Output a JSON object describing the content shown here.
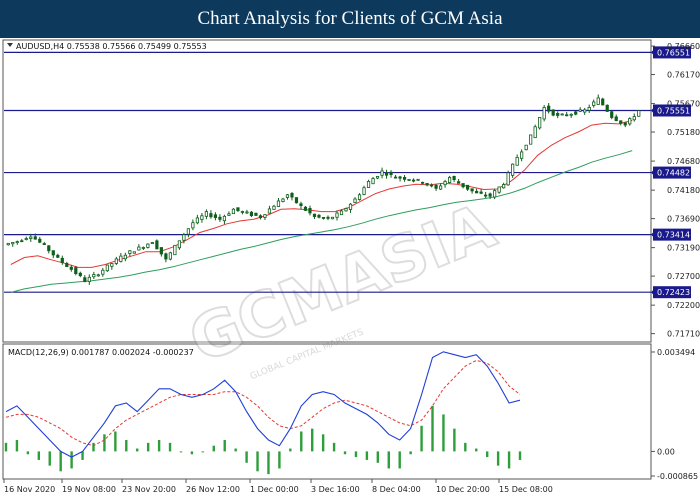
{
  "header": {
    "title": "Chart Analysis for Clients of GCM Asia"
  },
  "watermark": {
    "text": "GCMASIA",
    "subtext": "GLOBAL CAPITAL MARKETS"
  },
  "colors": {
    "level_line": "#1a1a8c",
    "level_label_bg": "#1a1a8c",
    "ma_fast": "#e53935",
    "ma_slow": "#2e9e5b",
    "candles": "#0f5f1c",
    "macd_line": "#1f3fd6",
    "macd_signal": "#e53935",
    "macd_hist": "#2e9e3a"
  },
  "chart_data": [
    {
      "type": "candlestick",
      "symbol_label": "AUDUSD,H4  0.75538 0.75566 0.75499 0.75553",
      "x_tick_labels": [
        "16 Nov 2020",
        "19 Nov 08:00",
        "23 Nov 20:00",
        "26 Nov 12:00",
        "1 Dec 00:00",
        "3 Dec 16:00",
        "8 Dec 04:00",
        "10 Dec 20:00",
        "15 Dec 08:00"
      ],
      "y_tick_labels": [
        "0.76660",
        "0.76170",
        "0.75670",
        "0.75180",
        "0.74680",
        "0.74180",
        "0.73690",
        "0.73190",
        "0.72700",
        "0.72200",
        "0.71710"
      ],
      "ylim": [
        0.716,
        0.7673
      ],
      "levels": [
        "0.76551",
        "0.75551",
        "0.74482",
        "0.73414",
        "0.72423"
      ],
      "close_path": [
        0.733,
        0.734,
        0.7322,
        0.73,
        0.7282,
        0.7262,
        0.7275,
        0.7292,
        0.7308,
        0.7318,
        0.733,
        0.7298,
        0.7332,
        0.7362,
        0.7378,
        0.7368,
        0.7385,
        0.7378,
        0.7372,
        0.7392,
        0.741,
        0.739,
        0.7372,
        0.7368,
        0.738,
        0.7402,
        0.7432,
        0.745,
        0.744,
        0.7438,
        0.7432,
        0.742,
        0.744,
        0.7425,
        0.7412,
        0.7408,
        0.743,
        0.7475,
        0.751,
        0.756,
        0.7545,
        0.755,
        0.7555,
        0.7575,
        0.7545,
        0.753,
        0.7555
      ],
      "ema_fast": [
        0.729,
        0.7302,
        0.7305,
        0.7298,
        0.7292,
        0.7285,
        0.7285,
        0.729,
        0.7298,
        0.7305,
        0.7312,
        0.7312,
        0.732,
        0.7332,
        0.7345,
        0.7352,
        0.736,
        0.7365,
        0.7368,
        0.7375,
        0.7385,
        0.7386,
        0.7384,
        0.7381,
        0.7381,
        0.7388,
        0.74,
        0.7412,
        0.742,
        0.7425,
        0.7428,
        0.7427,
        0.743,
        0.7428,
        0.7424,
        0.7419,
        0.742,
        0.7433,
        0.7452,
        0.7478,
        0.7495,
        0.7508,
        0.7518,
        0.753,
        0.7533,
        0.7532,
        0.7538
      ],
      "ema_slow": [
        0.7242,
        0.7248,
        0.7252,
        0.7256,
        0.7258,
        0.726,
        0.7262,
        0.7265,
        0.7268,
        0.7272,
        0.7277,
        0.7281,
        0.7286,
        0.7292,
        0.7298,
        0.7304,
        0.731,
        0.7316,
        0.7321,
        0.7327,
        0.7333,
        0.7338,
        0.7342,
        0.7346,
        0.735,
        0.7355,
        0.7361,
        0.7368,
        0.7374,
        0.7379,
        0.7384,
        0.7388,
        0.7393,
        0.7397,
        0.74,
        0.7403,
        0.7407,
        0.7413,
        0.7421,
        0.7431,
        0.744,
        0.7449,
        0.7457,
        0.7466,
        0.7473,
        0.7479,
        0.7486
      ]
    },
    {
      "type": "macd",
      "label": "MACD(12,26,9) 0.001787 0.002024 -0.000237",
      "y_tick_labels": [
        "0.003494",
        "0.00",
        "-0.000865"
      ],
      "ylim": [
        -0.000865,
        0.003494
      ],
      "macd_line": [
        0.0014,
        0.0016,
        0.0012,
        0.0008,
        0.0004,
        0.0,
        -0.0002,
        0.0,
        0.0005,
        0.001,
        0.0016,
        0.0017,
        0.0014,
        0.0018,
        0.0022,
        0.0022,
        0.002,
        0.0019,
        0.002,
        0.0022,
        0.0025,
        0.0021,
        0.0014,
        0.0008,
        0.0004,
        0.0002,
        0.0008,
        0.0016,
        0.002,
        0.0021,
        0.002,
        0.0017,
        0.0015,
        0.0013,
        0.001,
        0.0006,
        0.0004,
        0.0008,
        0.002,
        0.0033,
        0.0035,
        0.0034,
        0.0033,
        0.0034,
        0.003,
        0.0024,
        0.0017,
        0.0018
      ],
      "signal_line": [
        0.0012,
        0.0013,
        0.0013,
        0.0012,
        0.001,
        0.0008,
        0.0005,
        0.0003,
        0.0002,
        0.0004,
        0.0008,
        0.0011,
        0.0013,
        0.0015,
        0.0017,
        0.0019,
        0.002,
        0.002,
        0.002,
        0.002,
        0.0021,
        0.0021,
        0.0019,
        0.0016,
        0.0012,
        0.0009,
        0.0008,
        0.0009,
        0.0012,
        0.0015,
        0.0017,
        0.0018,
        0.0017,
        0.0016,
        0.0014,
        0.0012,
        0.001,
        0.0009,
        0.0011,
        0.0016,
        0.0022,
        0.0026,
        0.003,
        0.0032,
        0.0031,
        0.0028,
        0.0023,
        0.002
      ],
      "histogram": [
        0.0003,
        0.0004,
        -0.0001,
        -0.0003,
        -0.0005,
        -0.0007,
        -0.0006,
        -0.0003,
        0.0003,
        0.0006,
        0.0007,
        0.0004,
        0.0001,
        0.0003,
        0.0004,
        0.0003,
        0.0,
        -0.0001,
        0.0,
        0.0002,
        0.0004,
        0.0001,
        -0.0004,
        -0.0007,
        -0.0008,
        -0.0006,
        0.0001,
        0.0007,
        0.0008,
        0.0006,
        0.0003,
        -0.0001,
        -0.0002,
        -0.0003,
        -0.0004,
        -0.0006,
        -0.0006,
        -0.0001,
        0.0009,
        0.0016,
        0.0013,
        0.0008,
        0.0003,
        0.0001,
        -0.0002,
        -0.0005,
        -0.0006,
        -0.0003
      ]
    }
  ]
}
